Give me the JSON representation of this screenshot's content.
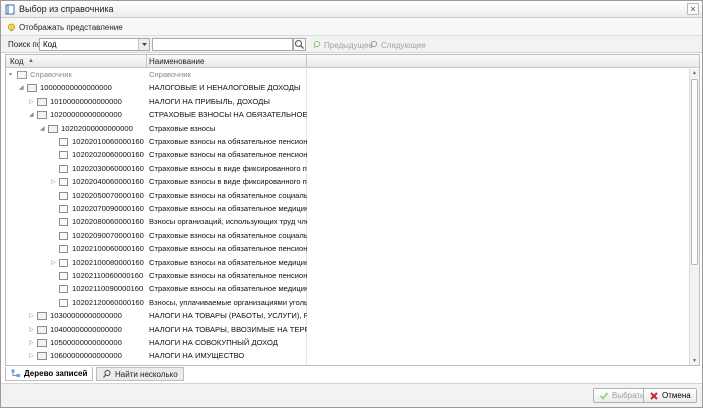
{
  "window": {
    "title": "Выбор из справочника",
    "close_label": "×"
  },
  "toolbar": {
    "show_view_label": "Отображать представление"
  },
  "search": {
    "label": "Поиск по",
    "field_value": "Код",
    "query_value": "",
    "prev_label": "Предыдущее",
    "next_label": "Следующее"
  },
  "grid": {
    "col_code": "Код",
    "col_name": "Наименование",
    "rows": [
      {
        "code": "Справочник",
        "name": "Справочник",
        "level": 0,
        "toggle": "▾",
        "icon": "book-icon",
        "dim": true
      },
      {
        "code": "10000000000000000",
        "name": "НАЛОГОВЫЕ И НЕНАЛОГОВЫЕ ДОХОДЫ",
        "level": 1,
        "toggle": "◢",
        "icon": "folder-icon"
      },
      {
        "code": "10100000000000000",
        "name": "НАЛОГИ НА ПРИБЫЛЬ, ДОХОДЫ",
        "level": 2,
        "toggle": "▷",
        "icon": "folder-icon"
      },
      {
        "code": "10200000000000000",
        "name": "СТРАХОВЫЕ ВЗНОСЫ НА ОБЯЗАТЕЛЬНОЕ СОЦ",
        "level": 2,
        "toggle": "◢",
        "icon": "folder-icon"
      },
      {
        "code": "10202000000000000",
        "name": "Страховые взносы",
        "level": 3,
        "toggle": "◢",
        "icon": "folder-icon"
      },
      {
        "code": "10202010060000160",
        "name": "Страховые взносы на обязательное пенсионно",
        "level": 4,
        "toggle": "",
        "icon": "leaf-icon"
      },
      {
        "code": "10202020060000160",
        "name": "Страховые взносы на обязательное пенсионно",
        "level": 4,
        "toggle": "",
        "icon": "leaf-icon"
      },
      {
        "code": "10202030060000160",
        "name": "Страховые взносы в виде фиксированного плат",
        "level": 4,
        "toggle": "",
        "icon": "leaf-icon"
      },
      {
        "code": "10202040060000160",
        "name": "Страховые взносы в виде фиксированного плат",
        "level": 4,
        "toggle": "▷",
        "icon": "leaf-icon"
      },
      {
        "code": "10202050070000160",
        "name": "Страховые взносы на обязательное социально",
        "level": 4,
        "toggle": "",
        "icon": "leaf-icon"
      },
      {
        "code": "10202070090000160",
        "name": "Страховые взносы на обязательное медицинск",
        "level": 4,
        "toggle": "",
        "icon": "leaf-icon"
      },
      {
        "code": "10202080060000160",
        "name": "Взносы организаций, использующих труд члено",
        "level": 4,
        "toggle": "",
        "icon": "leaf-icon"
      },
      {
        "code": "10202090070000160",
        "name": "Страховые взносы на обязательное социально",
        "level": 4,
        "toggle": "",
        "icon": "leaf-icon"
      },
      {
        "code": "10202100060000160",
        "name": "Страховые взносы на обязательное пенсионно",
        "level": 4,
        "toggle": "",
        "icon": "leaf-icon"
      },
      {
        "code": "10202100080000160",
        "name": "Страховые взносы на обязательное медицинск",
        "level": 4,
        "toggle": "▷",
        "icon": "leaf-icon"
      },
      {
        "code": "10202110060000160",
        "name": "Страховые взносы на обязательное пенсионно",
        "level": 4,
        "toggle": "",
        "icon": "leaf-icon"
      },
      {
        "code": "10202110090000160",
        "name": "Страховые взносы на обязательное медицинск",
        "level": 4,
        "toggle": "",
        "icon": "leaf-icon"
      },
      {
        "code": "10202120060000160",
        "name": "Взносы, уплачиваемые организациями угольно",
        "level": 4,
        "toggle": "",
        "icon": "leaf-icon"
      },
      {
        "code": "10300000000000000",
        "name": "НАЛОГИ НА ТОВАРЫ (РАБОТЫ, УСЛУГИ), РЕАЛ",
        "level": 2,
        "toggle": "▷",
        "icon": "folder-icon"
      },
      {
        "code": "10400000000000000",
        "name": "НАЛОГИ НА ТОВАРЫ, ВВОЗИМЫЕ НА ТЕРРИТО",
        "level": 2,
        "toggle": "▷",
        "icon": "folder-icon"
      },
      {
        "code": "10500000000000000",
        "name": "НАЛОГИ НА СОВОКУПНЫЙ ДОХОД",
        "level": 2,
        "toggle": "▷",
        "icon": "folder-icon"
      },
      {
        "code": "10600000000000000",
        "name": "НАЛОГИ НА ИМУЩЕСТВО",
        "level": 2,
        "toggle": "▷",
        "icon": "folder-icon"
      }
    ]
  },
  "tabs": {
    "tree_label": "Дерево записей",
    "multi_label": "Найти несколько"
  },
  "footer": {
    "select_label": "Выбрать",
    "cancel_label": "Отмена"
  },
  "colors": {
    "accent_green": "#5aa64a",
    "cancel_red": "#c62a2a"
  }
}
